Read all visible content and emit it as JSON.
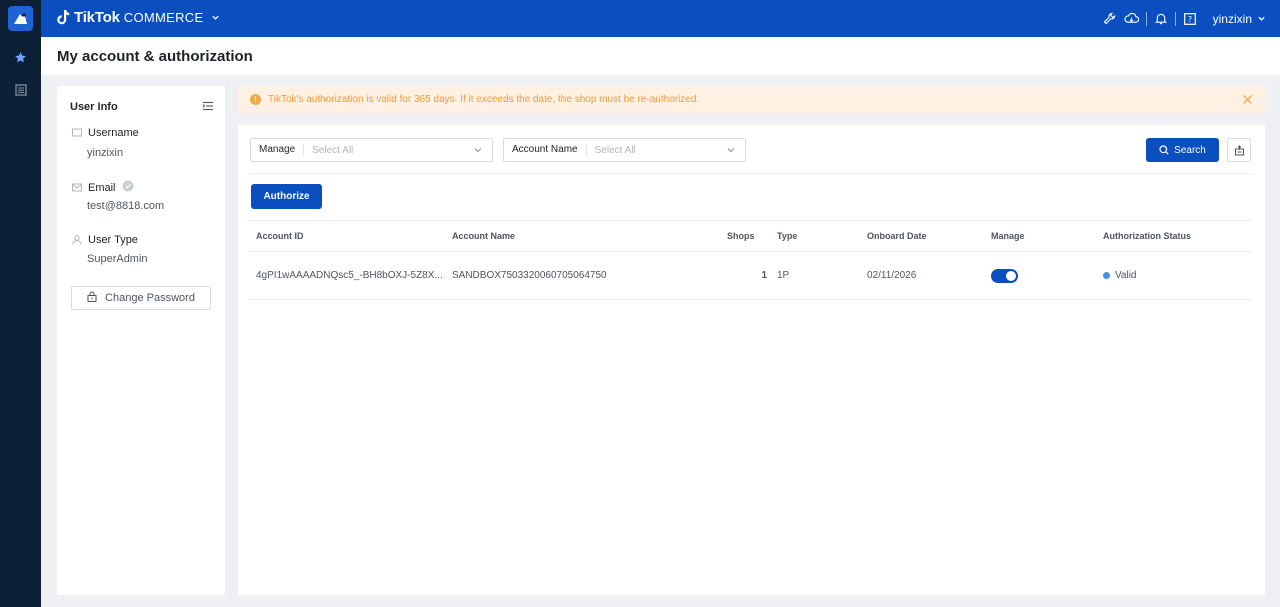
{
  "brand": {
    "tiktok": "TikTok",
    "commerce": "COMMERCE"
  },
  "topbar": {
    "username": "yinzixin"
  },
  "page": {
    "title": "My account & authorization"
  },
  "user_info": {
    "title": "User Info",
    "username_label": "Username",
    "username_value": "yinzixin",
    "email_label": "Email",
    "email_value": "test@8818.com",
    "user_type_label": "User Type",
    "user_type_value": "SuperAdmin",
    "change_password_label": "Change Password"
  },
  "notice": {
    "text": "TikTok's authorization is valid for 365 days. If it exceeds the date, the shop must be re-authorized."
  },
  "filters": {
    "manage_label": "Manage",
    "manage_placeholder": "Select All",
    "account_name_label": "Account Name",
    "account_name_placeholder": "Select All",
    "search_label": "Search"
  },
  "authorize_label": "Authorize",
  "table": {
    "headers": {
      "account_id": "Account ID",
      "account_name": "Account Name",
      "shops": "Shops",
      "type": "Type",
      "onboard_date": "Onboard Date",
      "manage": "Manage",
      "status": "Authorization Status"
    },
    "rows": [
      {
        "account_id": "4gPI1wAAAADNQsc5_-BH8bOXJ-5Z8X...",
        "account_name": "SANDBOX7503320060705064750",
        "shops": "1",
        "type": "1P",
        "onboard_date": "02/11/2026",
        "manage_on": true,
        "status": "Valid"
      }
    ]
  },
  "colors": {
    "primary": "#0a4ec0",
    "sidebar": "#0b1f35",
    "notice_bg": "#fdf1e3",
    "notice_text": "#ef9b3a",
    "status_valid": "#4a90e2"
  },
  "icons": [
    "app-logo-icon",
    "star-icon",
    "list-icon",
    "wrench-icon",
    "cloud-icon",
    "bell-icon",
    "help-icon",
    "chevron-down-icon",
    "menu-icon",
    "card-icon",
    "mail-icon",
    "verified-icon",
    "user-icon",
    "lock-icon",
    "warning-icon",
    "close-icon",
    "search-icon",
    "export-icon"
  ]
}
